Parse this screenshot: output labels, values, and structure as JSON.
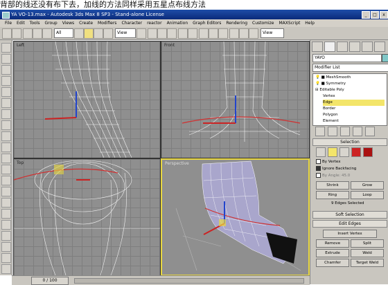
{
  "caption": "背部的线还没有布下去，加线的方法同样采用五星点布线方法",
  "window": {
    "title": "YA VO-13.max - Autodesk 3ds Max 8 SP3 - Stand-alone License"
  },
  "menu": [
    "File",
    "Edit",
    "Tools",
    "Group",
    "Views",
    "Create",
    "Modifiers",
    "Character",
    "reactor",
    "Animation",
    "Graph Editors",
    "Rendering",
    "Customize",
    "MAXScript",
    "Help"
  ],
  "toolbar": {
    "filter_select": "All",
    "view_select": "View",
    "view_select2": "View"
  },
  "viewports": [
    {
      "label": "Left"
    },
    {
      "label": "Front"
    },
    {
      "label": "Top"
    },
    {
      "label": "Perspective"
    }
  ],
  "timeline": {
    "frame": "0 / 100"
  },
  "command_panel": {
    "object_name": "YAYO",
    "modifier_list": "Modifier List",
    "stack": [
      "MeshSmooth",
      "Symmetry",
      "Editable Poly",
      "Vertex",
      "Edge",
      "Border",
      "Polygon",
      "Element"
    ],
    "selected_stack_item": "Edge",
    "selection_rollout": "Selection",
    "by_vertex": "By Vertex",
    "ignore_backfacing": "Ignore Backfacing",
    "by_angle": "By Angle:",
    "angle_value": "45.0",
    "shrink": "Shrink",
    "grow": "Grow",
    "ring": "Ring",
    "loop": "Loop",
    "status": "9 Edges Selected",
    "soft_selection": "Soft Selection",
    "edit_edges": "Edit Edges",
    "insert_vertex": "Insert Vertex",
    "remove": "Remove",
    "split": "Split",
    "extrude": "Extrude",
    "weld": "Weld",
    "chamfer": "Chamfer",
    "target_weld": "Target Weld"
  },
  "colors": {
    "active_viewport_border": "#e8d740",
    "highlight": "#f3e56a",
    "mesh_wire": "#ffffff"
  }
}
